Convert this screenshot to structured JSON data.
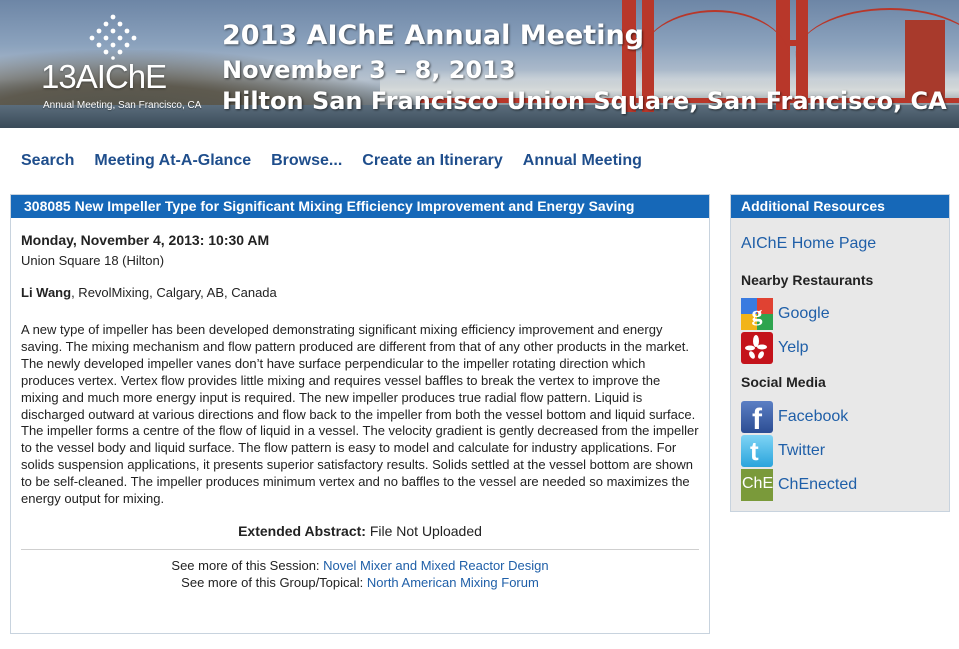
{
  "banner": {
    "logo_number": "13",
    "logo_brand": "AIChE",
    "logo_tagline": "Annual Meeting, San Francisco, CA",
    "line1": "2013 AIChE Annual Meeting",
    "line2": "November 3 – 8, 2013",
    "line3": "Hilton San Francisco Union Square, San Francisco, CA"
  },
  "nav": {
    "items": [
      "Search",
      "Meeting At-A-Glance",
      "Browse...",
      "Create an Itinerary",
      "Annual Meeting"
    ]
  },
  "paper": {
    "header": "308085  New Impeller Type for Significant Mixing Efficiency Improvement and Energy Saving",
    "datetime": "Monday, November 4, 2013: 10:30 AM",
    "room": "Union Square 18 (Hilton)",
    "author_name": "Li Wang",
    "author_affiliation": ", RevolMixing, Calgary, AB, Canada",
    "abstract": "A new type of impeller has been developed demonstrating significant mixing efficiency improvement and energy saving.  The mixing mechanism and flow pattern produced are different from that of any other products in the market.  The newly developed impeller vanes don’t have surface perpendicular to the impeller rotating direction which produces vertex. Vertex flow provides little mixing and requires vessel baffles to break the vertex to improve the mixing and much more energy input is required.  The new impeller produces true radial flow pattern.  Liquid is discharged outward at various directions and flow back to the impeller from both the vessel bottom and liquid surface.  The impeller forms a centre of the flow of liquid in a vessel.  The velocity gradient is gently decreased from the impeller to the vessel body and liquid surface.  The flow pattern is easy to model and calculate for industry applications. For solids suspension applications, it presents superior satisfactory results.  Solids settled at the vessel bottom are shown to be self-cleaned.  The impeller produces minimum vertex and no baffles to the vessel are needed so maximizes the energy output for mixing.",
    "extended_label": "Extended Abstract:",
    "extended_value": " File Not Uploaded",
    "session_prefix": "See more of this Session: ",
    "session_link": "Novel Mixer and Mixed Reactor Design",
    "group_prefix": "See more of this Group/Topical: ",
    "group_link": "North American Mixing Forum"
  },
  "sidebar": {
    "header": "Additional Resources",
    "home_link": "AIChE Home Page",
    "restaurants_label": "Nearby Restaurants",
    "restaurants": [
      {
        "label": "Google",
        "icon": "google-icon"
      },
      {
        "label": "Yelp",
        "icon": "yelp-icon"
      }
    ],
    "social_label": "Social Media",
    "social": [
      {
        "label": "Facebook",
        "icon": "facebook-icon"
      },
      {
        "label": "Twitter",
        "icon": "twitter-icon"
      },
      {
        "label": "ChEnected",
        "icon": "chenected-icon",
        "icon_text": "ChE"
      }
    ]
  },
  "colors": {
    "header_blue": "#1668b8",
    "link_blue": "#1f5fa8",
    "nav_blue": "#1f4e8c",
    "bridge_red": "#b8372a"
  }
}
